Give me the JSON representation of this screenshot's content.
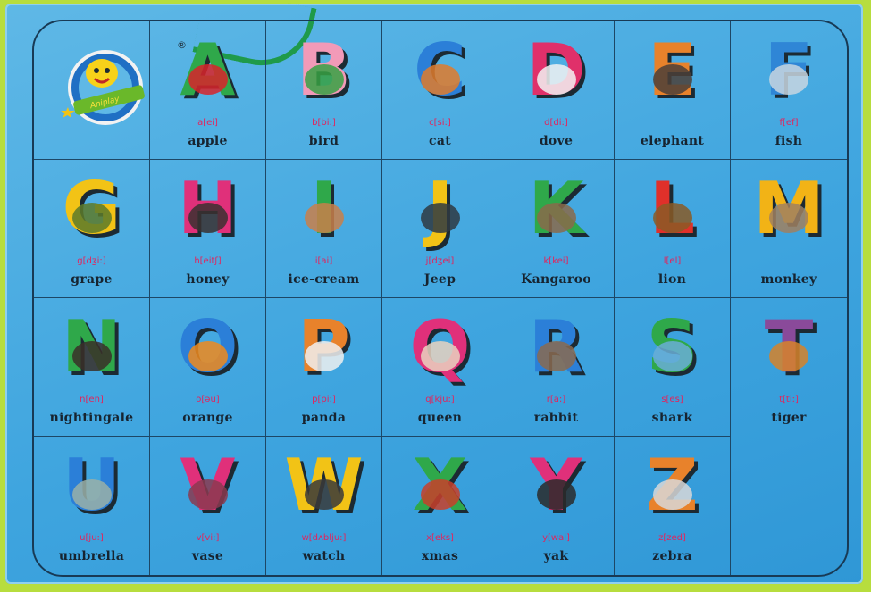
{
  "logo": {
    "brand_text": "Aniplay",
    "reg_mark": "®"
  },
  "cards": [
    {
      "letter": "A",
      "phonetic": "a[ei]",
      "word": "apple",
      "color": "#2fa84a",
      "pic": "#d8232a",
      "icon": "apple-icon"
    },
    {
      "letter": "B",
      "phonetic": "b[bi:]",
      "word": "bird",
      "color": "#f29ab8",
      "pic": "#37a143",
      "icon": "parrot-icon"
    },
    {
      "letter": "C",
      "phonetic": "c[si:]",
      "word": "cat",
      "color": "#2b7fd8",
      "pic": "#e07b2c",
      "icon": "cat-icon"
    },
    {
      "letter": "D",
      "phonetic": "d[di:]",
      "word": "dove",
      "color": "#e0306a",
      "pic": "#f2f2f2",
      "icon": "dove-icon"
    },
    {
      "letter": "E",
      "phonetic": "",
      "word": "elephant",
      "color": "#e8822b",
      "pic": "#4b4038",
      "icon": "elephant-icon"
    },
    {
      "letter": "F",
      "phonetic": "f[ef]",
      "word": "fish",
      "color": "#2f86d6",
      "pic": "#c8d6e0",
      "icon": "fish-icon"
    },
    {
      "letter": "G",
      "phonetic": "g[dʒi:]",
      "word": "grape",
      "color": "#f2c316",
      "pic": "#5c7a2a",
      "icon": "grape-icon"
    },
    {
      "letter": "H",
      "phonetic": "h[eitʃ]",
      "word": "honey",
      "color": "#e0307a",
      "pic": "#3a3030",
      "icon": "honey-icon"
    },
    {
      "letter": "I",
      "phonetic": "i[ai]",
      "word": "ice-cream",
      "color": "#2fa84a",
      "pic": "#c97f4a",
      "icon": "ice-cream-icon"
    },
    {
      "letter": "J",
      "phonetic": "j[dʒei]",
      "word": "Jeep",
      "color": "#f2c316",
      "pic": "#2f3a42",
      "icon": "jeep-icon"
    },
    {
      "letter": "K",
      "phonetic": "k[kei]",
      "word": "Kangaroo",
      "color": "#2fa84a",
      "pic": "#8a6a4a",
      "icon": "kangaroo-icon"
    },
    {
      "letter": "L",
      "phonetic": "l[el]",
      "word": "lion",
      "color": "#e0302a",
      "pic": "#8a5a26",
      "icon": "lion-icon"
    },
    {
      "letter": "M",
      "phonetic": "",
      "word": "monkey",
      "color": "#f2b316",
      "pic": "#a08060",
      "icon": "monkey-icon"
    },
    {
      "letter": "N",
      "phonetic": "n[en]",
      "word": "nightingale",
      "color": "#2fa84a",
      "pic": "#3a2f28",
      "icon": "nightingale-icon"
    },
    {
      "letter": "O",
      "phonetic": "o[əu]",
      "word": "orange",
      "color": "#2b7fd8",
      "pic": "#f08a1c",
      "icon": "orange-icon"
    },
    {
      "letter": "P",
      "phonetic": "p[pi:]",
      "word": "panda",
      "color": "#e8822b",
      "pic": "#f0f0f0",
      "icon": "panda-icon"
    },
    {
      "letter": "Q",
      "phonetic": "q[kju:]",
      "word": "queen",
      "color": "#e0307a",
      "pic": "#e9d2c0",
      "icon": "queen-icon"
    },
    {
      "letter": "R",
      "phonetic": "r[a:]",
      "word": "rabbit",
      "color": "#2b7fd8",
      "pic": "#8a6a50",
      "icon": "rabbit-icon"
    },
    {
      "letter": "S",
      "phonetic": "s[es]",
      "word": "shark",
      "color": "#2fa84a",
      "pic": "#6aaed6",
      "icon": "shark-icon"
    },
    {
      "letter": "T",
      "phonetic": "t[ti:]",
      "word": "tiger",
      "color": "#8a4a9a",
      "pic": "#d6822a",
      "icon": "tiger-icon"
    },
    {
      "letter": "U",
      "phonetic": "u[ju:]",
      "word": "umbrella",
      "color": "#2b7fd8",
      "pic": "#9ab0a8",
      "icon": "umbrella-icon"
    },
    {
      "letter": "V",
      "phonetic": "v[vi:]",
      "word": "vase",
      "color": "#e0307a",
      "pic": "#8a3a50",
      "icon": "vase-icon"
    },
    {
      "letter": "W",
      "phonetic": "w[dʌblju:]",
      "word": "watch",
      "color": "#f2c316",
      "pic": "#3a3a3a",
      "icon": "watch-icon"
    },
    {
      "letter": "X",
      "phonetic": "x[eks]",
      "word": "xmas",
      "color": "#2fa84a",
      "pic": "#c8402a",
      "icon": "xmas-icon"
    },
    {
      "letter": "Y",
      "phonetic": "y[wai]",
      "word": "yak",
      "color": "#e0307a",
      "pic": "#2a2a2a",
      "icon": "yak-icon"
    },
    {
      "letter": "Z",
      "phonetic": "z[zed]",
      "word": "zebra",
      "color": "#e8822b",
      "pic": "#d8d8d8",
      "icon": "zebra-icon"
    }
  ]
}
